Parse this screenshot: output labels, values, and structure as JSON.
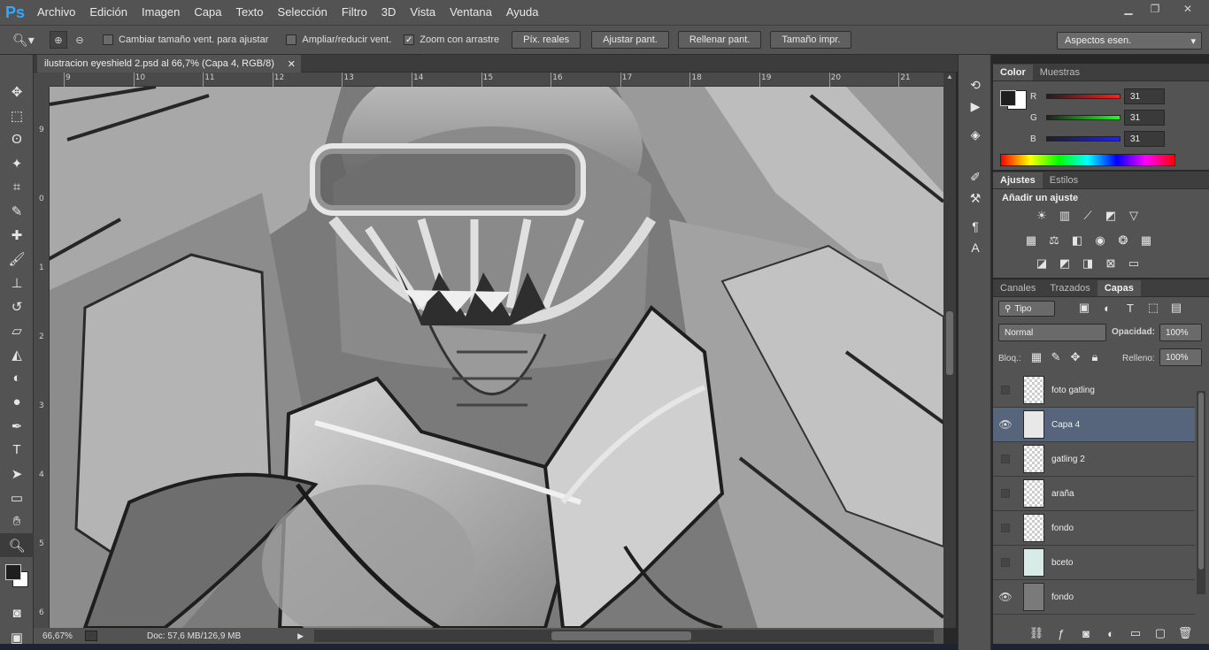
{
  "app": {
    "logo": "Ps"
  },
  "menu": [
    "Archivo",
    "Edición",
    "Imagen",
    "Capa",
    "Texto",
    "Selección",
    "Filtro",
    "3D",
    "Vista",
    "Ventana",
    "Ayuda"
  ],
  "options": {
    "resize_windows": "Cambiar tamaño vent. para ajustar",
    "zoom_all": "Ampliar/reducir vent.",
    "scrubby_zoom": "Zoom con arrastre",
    "actual_pixels": "Píx. reales",
    "fit_screen": "Ajustar pant.",
    "fill_screen": "Rellenar pant.",
    "print_size": "Tamaño impr.",
    "workspace": "Aspectos esen."
  },
  "document": {
    "tab_title": "ilustracion eyeshield 2.psd al 66,7% (Capa 4, RGB/8)",
    "zoom": "66,67%",
    "doc_size": "Doc: 57,6 MB/126,9 MB"
  },
  "ruler": {
    "top": [
      "9",
      "10",
      "11",
      "12",
      "13",
      "14",
      "15",
      "16",
      "17",
      "18",
      "19",
      "20",
      "21"
    ],
    "left": [
      "9",
      "0",
      "1",
      "2",
      "3",
      "4",
      "5",
      "6"
    ]
  },
  "color_panel": {
    "tabs": [
      "Color",
      "Muestras"
    ],
    "r_label": "R",
    "g_label": "G",
    "b_label": "B",
    "r": "31",
    "g": "31",
    "b": "31",
    "foreground": "#1f1f1f",
    "background": "#ffffff"
  },
  "adjust_panel": {
    "tabs": [
      "Ajustes",
      "Estilos"
    ],
    "heading": "Añadir un ajuste"
  },
  "layers_panel": {
    "tabs": [
      "Canales",
      "Trazados",
      "Capas"
    ],
    "filter_kind": "Tipo",
    "blend_mode": "Normal",
    "opacity_label": "Opacidad:",
    "opacity": "100%",
    "lock_label": "Bloq.:",
    "fill_label": "Relleno:",
    "fill": "100%",
    "layers": [
      {
        "name": "foto gatling",
        "visible": false
      },
      {
        "name": "Capa 4",
        "visible": true
      },
      {
        "name": "gatling 2",
        "visible": false
      },
      {
        "name": "araña",
        "visible": false
      },
      {
        "name": "fondo",
        "visible": false
      },
      {
        "name": "bceto",
        "visible": false
      },
      {
        "name": "fondo",
        "visible": true
      }
    ]
  }
}
